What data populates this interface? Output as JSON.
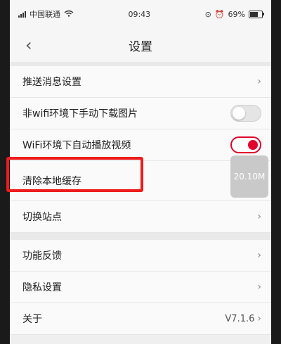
{
  "status": {
    "carrier": "中国联通",
    "time": "09:43",
    "battery": "69%"
  },
  "header": {
    "title": "设置"
  },
  "settings": {
    "push": "推送消息设置",
    "non_wifi_download": "非wifi环境下手动下载图片",
    "wifi_autoplay": "WiFi环境下自动播放视频",
    "clear_cache": "清除本地缓存",
    "cache_size": "20.10M",
    "switch_site": "切换站点",
    "feedback": "功能反馈",
    "privacy": "隐私设置",
    "about": "关于",
    "version": "V7.1.6"
  },
  "toggles": {
    "non_wifi_download": false,
    "wifi_autoplay": true
  },
  "colors": {
    "accent": "#e0002a",
    "highlight": "#ee1c1c"
  }
}
